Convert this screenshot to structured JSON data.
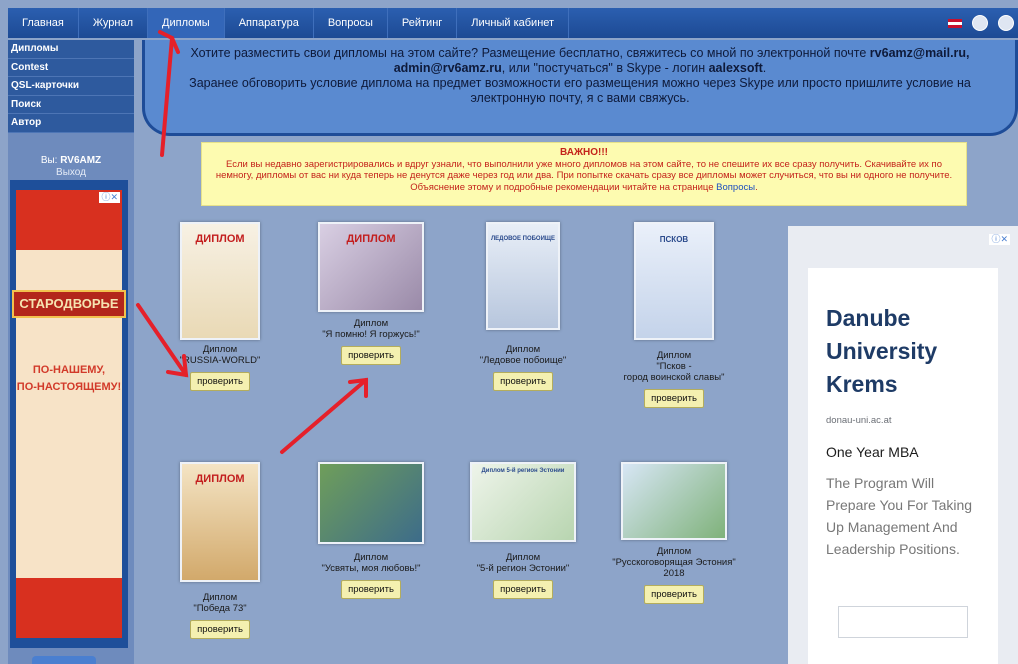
{
  "nav": {
    "items": [
      "Главная",
      "Журнал",
      "Дипломы",
      "Аппаратура",
      "Вопросы",
      "Рейтинг",
      "Личный кабинет"
    ],
    "active_index": 2
  },
  "sidebar": {
    "items": [
      "Дипломы",
      "Contest",
      "QSL-карточки",
      "Поиск",
      "Автор"
    ],
    "user_prefix": "Вы:",
    "username": "RV6AMZ",
    "logout": "Выход",
    "ad": {
      "logo": "СТАРОДВОРЬЕ",
      "line1": "ПО-НАШЕМУ,",
      "line2": "ПО-НАСТОЯЩЕМУ!"
    }
  },
  "info_banner": {
    "text1": "Хотите разместить свои дипломы на этом сайте? Размещение бесплатно, свяжитесь со мной по электронной почте ",
    "email1": "rv6amz@mail.ru,",
    "email2": "admin@rv6amz.ru",
    "text2": ", или \"постучаться\" в Skype - логин ",
    "skype": "aalexsoft",
    "text3": ".",
    "text4": "Заранее обговорить условие диплома на предмет возможности его размещения можно через Skype или просто пришлите условие на электронную почту, я с вами свяжусь."
  },
  "warning": {
    "title": "ВАЖНО!!!",
    "text": "Если вы недавно зарегистрировались и вдруг узнали, что выполнили уже много дипломов на этом сайте, то не спешите их все сразу получить. Скачивайте их по немногу, дипломы от вас ни куда теперь не денутся даже через год или два. При попытке скачать сразу все дипломы может случиться, что вы ни одного не получите. Объяснение этому и подробные рекомендации читайте на странице ",
    "link": "Вопросы",
    "end": "."
  },
  "diplomas": [
    {
      "line1": "Диплом",
      "line2": "\"RUSSIA-WORLD\"",
      "line3": "",
      "button": "проверить",
      "thumb_title": "ДИПЛОМ"
    },
    {
      "line1": "Диплом",
      "line2": "\"Я помню! Я горжусь!\"",
      "line3": "",
      "button": "проверить",
      "thumb_title": "ДИПЛОМ"
    },
    {
      "line1": "Диплом",
      "line2": "\"Ледовое побоище\"",
      "line3": "",
      "button": "проверить",
      "thumb_title": "ЛЕДОВОЕ ПОБОИЩЕ"
    },
    {
      "line1": "Диплом",
      "line2": "\"Псков -",
      "line3": "город воинской славы\"",
      "button": "проверить",
      "thumb_title": "ПСКОВ"
    },
    {
      "line1": "Диплом",
      "line2": "\"Победа 73\"",
      "line3": "",
      "button": "проверить",
      "thumb_title": "ДИПЛОМ"
    },
    {
      "line1": "Диплом",
      "line2": "\"Усвяты, моя любовь!\"",
      "line3": "",
      "button": "проверить",
      "thumb_title": ""
    },
    {
      "line1": "Диплом",
      "line2": "\"5-й регион Эстонии\"",
      "line3": "",
      "button": "проверить",
      "thumb_title": "Диплом 5-й регион Эстонии"
    },
    {
      "line1": "Диплом",
      "line2": "\"Русскоговорящая Эстония\"",
      "line3": "2018",
      "button": "проверить",
      "thumb_title": ""
    }
  ],
  "right_ad": {
    "head1": "Danube",
    "head2": "University",
    "head3": "Krems",
    "domain": "donau-uni.ac.at",
    "sub": "One Year MBA",
    "body": "The Program Will Prepare You For Taking Up Management And Leadership Positions."
  },
  "colors": {
    "nav_bg": "#1d4a94",
    "banner_bg": "#5a8ad0",
    "warning_bg": "#fdfbb0",
    "annotation": "#e5202a"
  }
}
